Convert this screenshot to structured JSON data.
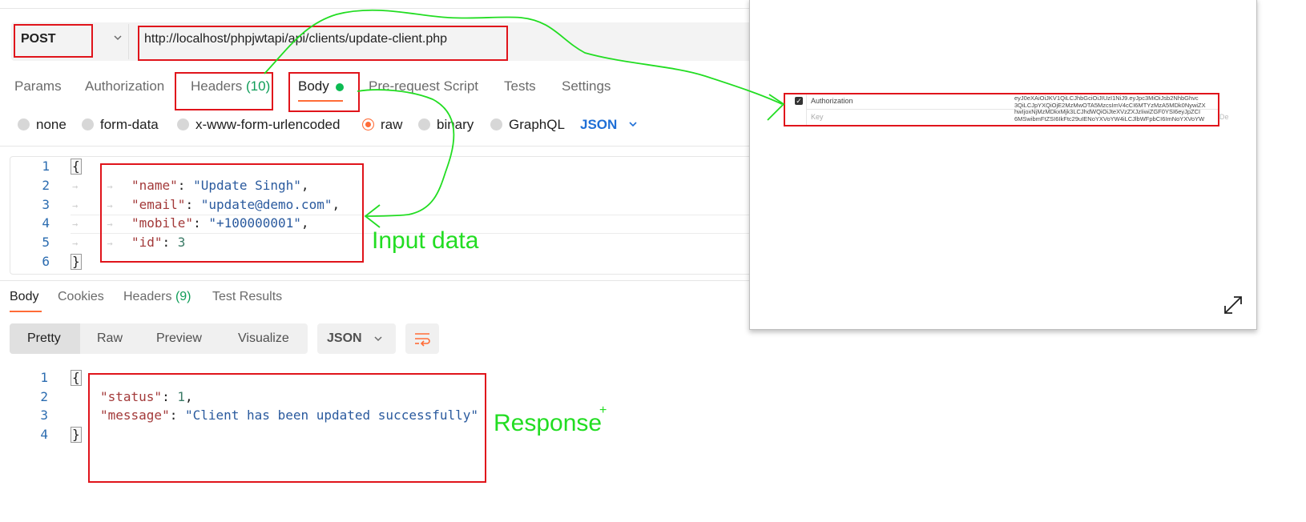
{
  "request": {
    "method": "POST",
    "url": "http://localhost/phpjwtapi/api/clients/update-client.php"
  },
  "request_tabs": {
    "params": "Params",
    "authorization": "Authorization",
    "headers_label": "Headers",
    "headers_count": "(10)",
    "body": "Body",
    "prerequest": "Pre-request Script",
    "tests": "Tests",
    "settings": "Settings"
  },
  "body_types": {
    "none": "none",
    "form_data": "form-data",
    "urlencoded": "x-www-form-urlencoded",
    "raw": "raw",
    "binary": "binary",
    "graphql": "GraphQL",
    "format": "JSON"
  },
  "request_body": {
    "line_numbers": [
      "1",
      "2",
      "3",
      "4",
      "5",
      "6"
    ],
    "open": "{",
    "close": "}",
    "name_key": "\"name\"",
    "name_val": "\"Update Singh\"",
    "email_key": "\"email\"",
    "email_val": "\"update@demo.com\"",
    "mobile_key": "\"mobile\"",
    "mobile_val": "\"+100000001\"",
    "id_key": "\"id\"",
    "id_val": "3"
  },
  "response_tabs": {
    "body": "Body",
    "cookies": "Cookies",
    "headers_label": "Headers",
    "headers_count": "(9)",
    "test_results": "Test Results"
  },
  "response_view": {
    "pretty": "Pretty",
    "raw": "Raw",
    "preview": "Preview",
    "visualize": "Visualize",
    "format": "JSON"
  },
  "response_body": {
    "line_numbers": [
      "1",
      "2",
      "3",
      "4"
    ],
    "open": "{",
    "close": "}",
    "status_key": "\"status\"",
    "status_val": "1",
    "message_key": "\"message\"",
    "message_val": "\"Client has been updated successfully\""
  },
  "annotations": {
    "input_data": "Input data",
    "response": "Response",
    "plus": "+"
  },
  "popup": {
    "auth_key": "Authorization",
    "key_placeholder": "Key",
    "auth_value_lines": [
      "eyJ0eXAiOiJKV1QiLCJhbGciOiJIUzI1NiJ9.eyJpc3MiOiJsb2NhbGhvc",
      "3QiLCJpYXQiOjE2MzMwOTA5MzcsImV4cCI6MTYzMzA5MDk0NywiZX",
      "hwIjoxNjMzMDkxMjk3LCJhdWQiOiJteXVzZXJzIiwiZGF0YSI6eyJpZCI",
      "6MSwibmFtZSI6IkFtc29uIENoYXVoYW4iLCJlbWFpbCI6ImNoYXVoYW"
    ],
    "trailing": "De"
  },
  "colors": {
    "accent": "#ff6c37",
    "link_blue": "#1f6fd6",
    "annotation_green": "#22dd22",
    "annotation_red": "#e0141b",
    "status_green": "#0cbb52"
  }
}
